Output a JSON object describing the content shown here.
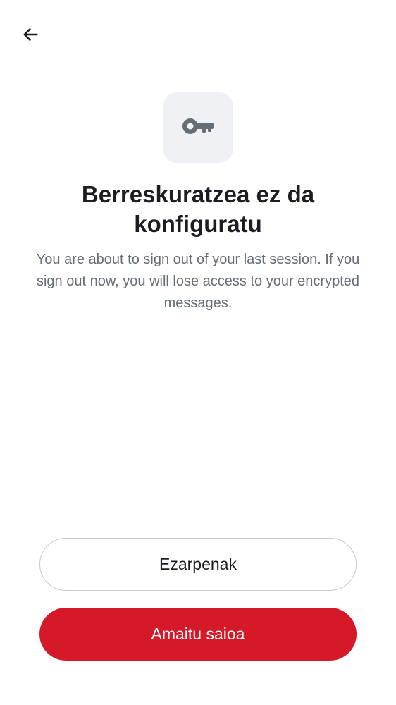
{
  "header": {
    "back_icon": "arrow-left-icon"
  },
  "hero": {
    "icon": "key-icon",
    "icon_tile_color": "#eff1f5",
    "icon_color": "#656d77"
  },
  "content": {
    "title": "Berreskuratzea ez da konfiguratu",
    "description": "You are about to sign out of your last session. If you sign out now, you will lose access to your encrypted messages."
  },
  "actions": {
    "settings_label": "Ezarpenak",
    "sign_out_label": "Amaitu saioa",
    "sign_out_color": "#d51928"
  }
}
